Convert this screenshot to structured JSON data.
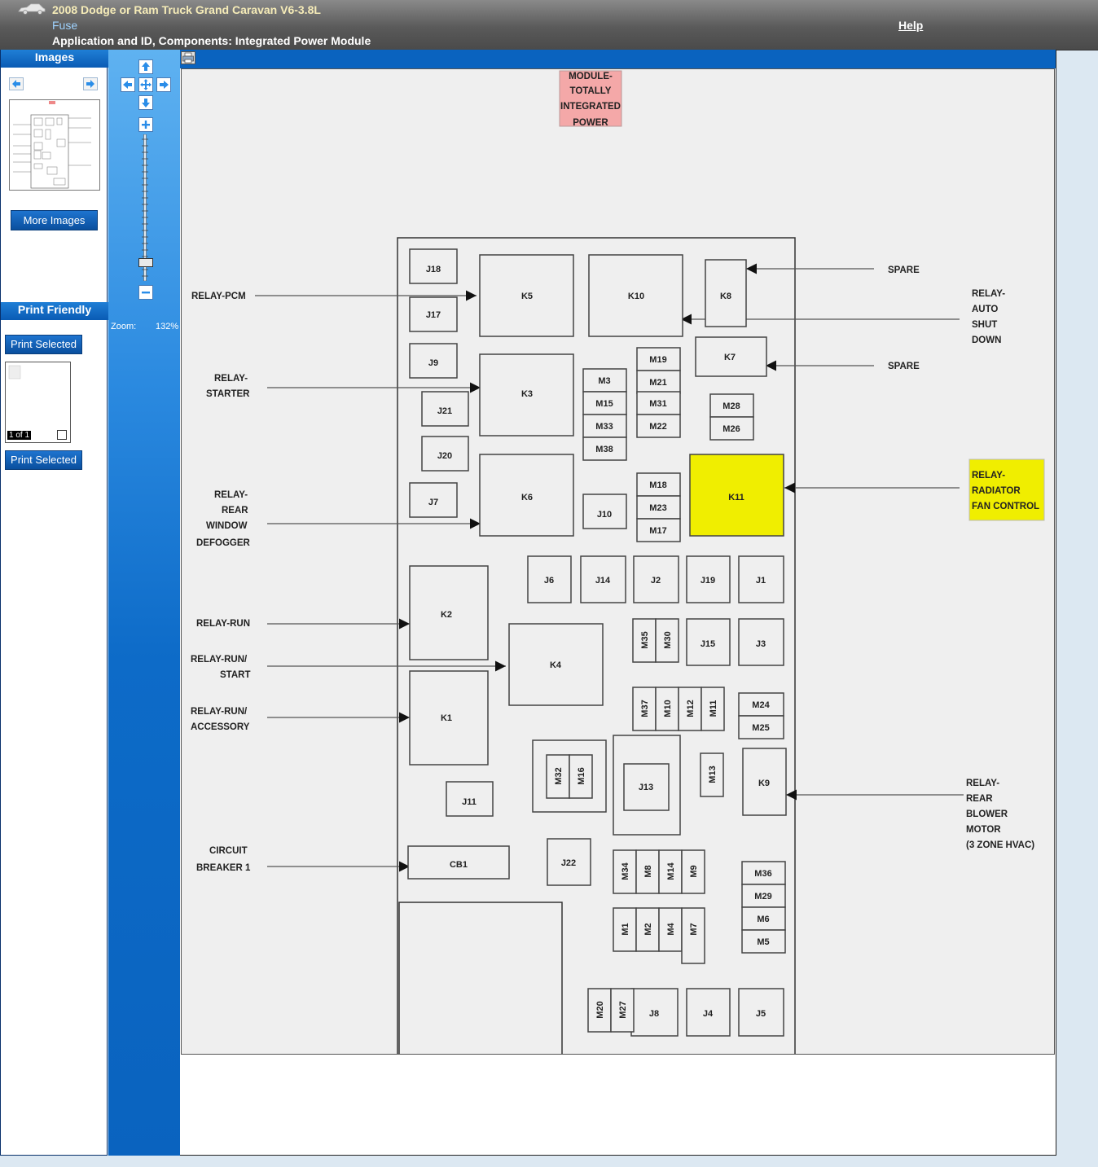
{
  "header": {
    "title": "2008 Dodge or Ram Truck Grand Caravan V6-3.8L",
    "subtitle": "Fuse",
    "application": "Application and ID, Components: Integrated Power Module",
    "help_label": "Help"
  },
  "left_panel": {
    "images_header": "Images",
    "more_images_label": "More Images",
    "print_friendly_header": "Print Friendly",
    "print_selected_label": "Print Selected",
    "page_count": "1 of 1"
  },
  "zoom": {
    "label": "Zoom:",
    "value": "132%"
  },
  "diagram": {
    "title_lines": [
      "MODULE-",
      "TOTALLY",
      "INTEGRATED",
      "POWER"
    ],
    "callouts": {
      "spare1": "SPARE",
      "relay_asd": [
        "RELAY-",
        "AUTO",
        "SHUT",
        "DOWN"
      ],
      "spare2": "SPARE",
      "relay_fan": [
        "RELAY-",
        "RADIATOR",
        "FAN CONTROL"
      ],
      "relay_blower": [
        "RELAY-",
        "REAR",
        "BLOWER",
        "MOTOR",
        "(3 ZONE HVAC)"
      ],
      "relay_pcm": "RELAY-PCM",
      "relay_starter": [
        "RELAY-",
        "STARTER"
      ],
      "relay_defogger": [
        "RELAY-",
        "REAR",
        "WINDOW",
        "DEFOGGER"
      ],
      "relay_run": "RELAY-RUN",
      "relay_run_start": [
        "RELAY-RUN/",
        "START"
      ],
      "relay_run_acc": [
        "RELAY-RUN/",
        "ACCESSORY"
      ],
      "circuit_breaker": [
        "CIRCUIT",
        "BREAKER 1"
      ]
    },
    "components": {
      "K5": "K5",
      "K10": "K10",
      "K8": "K8",
      "K7": "K7",
      "K3": "K3",
      "K6": "K6",
      "K11": "K11",
      "K2": "K2",
      "K4": "K4",
      "K1": "K1",
      "K9": "K9",
      "J18": "J18",
      "J17": "J17",
      "J9": "J9",
      "J21": "J21",
      "J20": "J20",
      "J7": "J7",
      "J10": "J10",
      "J6": "J6",
      "J14": "J14",
      "J2": "J2",
      "J19": "J19",
      "J1": "J1",
      "J15": "J15",
      "J3": "J3",
      "J13": "J13",
      "J11": "J11",
      "J22": "J22",
      "J8": "J8",
      "J4": "J4",
      "J5": "J5",
      "CB1": "CB1",
      "M3": "M3",
      "M15": "M15",
      "M33": "M33",
      "M38": "M38",
      "M19": "M19",
      "M21": "M21",
      "M31": "M31",
      "M22": "M22",
      "M28": "M28",
      "M26": "M26",
      "M18": "M18",
      "M23": "M23",
      "M17": "M17",
      "M35": "M35",
      "M30": "M30",
      "M37": "M37",
      "M10": "M10",
      "M12": "M12",
      "M11": "M11",
      "M24": "M24",
      "M25": "M25",
      "M32": "M32",
      "M16": "M16",
      "M13": "M13",
      "M34": "M34",
      "M8": "M8",
      "M14": "M14",
      "M9": "M9",
      "M36": "M36",
      "M29": "M29",
      "M6": "M6",
      "M5": "M5",
      "M1": "M1",
      "M2": "M2",
      "M4": "M4",
      "M7": "M7",
      "M20": "M20",
      "M27": "M27"
    },
    "colors": {
      "highlight": "#f0ee00",
      "title_box": "#f4a8a8",
      "background": "#efefef"
    }
  }
}
